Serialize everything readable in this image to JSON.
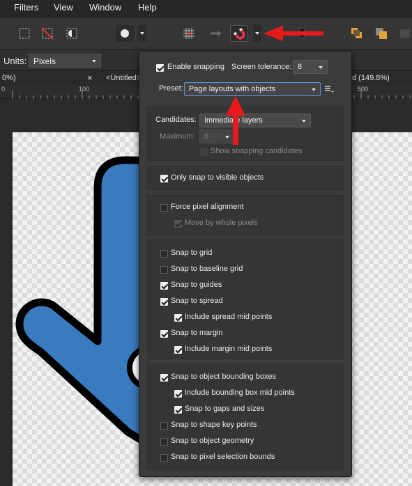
{
  "menubar": {
    "items": [
      "Filters",
      "View",
      "Window",
      "Help"
    ]
  },
  "context": {
    "units_label": "Units:",
    "units_value": "Pixels"
  },
  "tabs": {
    "left_zoom": "0%)",
    "close_glyph": "×",
    "untitled": "<Untitled>",
    "right_zoom": "d (149.8%)"
  },
  "ruler": {
    "labels": [
      "0",
      "100",
      "500"
    ]
  },
  "snapping": {
    "enable_label": "Enable snapping",
    "enable_checked": true,
    "tolerance_label": "Screen tolerance:",
    "tolerance_value": "8",
    "preset_label": "Preset:",
    "preset_value": "Page layouts with objects",
    "candidates_label": "Candidates:",
    "candidates_value": "Immediate layers",
    "maximum_label": "Maximum:",
    "maximum_value": "6",
    "show_candidates_label": "Show snapping candidates",
    "visible_only_label": "Only snap to visible objects",
    "force_pixel_label": "Force pixel alignment",
    "whole_pixels_label": "Move by whole pixels",
    "options": [
      {
        "label": "Snap to grid",
        "checked": false
      },
      {
        "label": "Snap to baseline grid",
        "checked": false
      },
      {
        "label": "Snap to guides",
        "checked": true
      },
      {
        "label": "Snap to spread",
        "checked": true
      },
      {
        "label": "Include spread mid points",
        "checked": true
      },
      {
        "label": "Snap to margin",
        "checked": true
      },
      {
        "label": "Include margin mid points",
        "checked": true
      }
    ],
    "object_options": [
      {
        "label": "Snap to object bounding boxes",
        "checked": true
      },
      {
        "label": "Include bounding box mid points",
        "checked": true
      },
      {
        "label": "Snap to gaps and sizes",
        "checked": true
      },
      {
        "label": "Snap to shape key points",
        "checked": false
      },
      {
        "label": "Snap to object geometry",
        "checked": false
      },
      {
        "label": "Snap to pixel selection bounds",
        "checked": false
      }
    ]
  },
  "colors": {
    "arrow": "#e8191d",
    "shape_fill": "#3a7bbf",
    "magnet": "#d9334a"
  }
}
